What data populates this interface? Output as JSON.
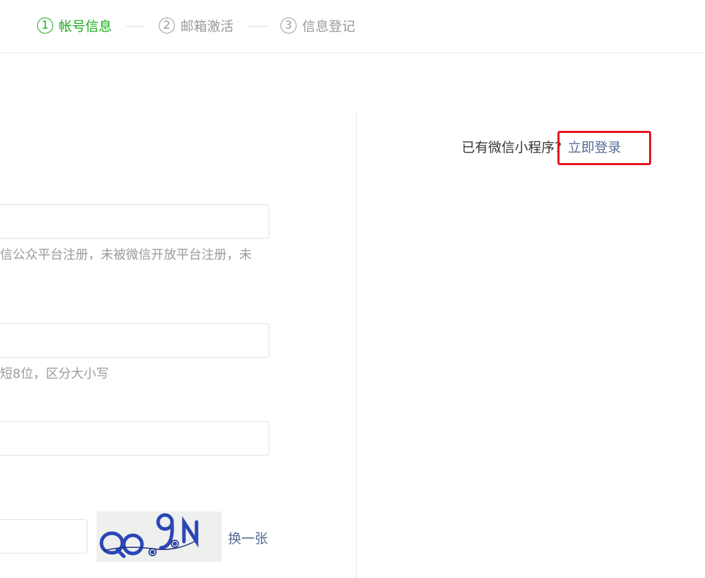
{
  "steps": [
    {
      "num": "1",
      "label": "帐号信息",
      "active": true
    },
    {
      "num": "2",
      "label": "邮箱激活",
      "active": false
    },
    {
      "num": "3",
      "label": "信息登记",
      "active": false
    }
  ],
  "form": {
    "email_tip": "信公众平台注册，未被微信开放平台注册，未",
    "password_tip": "短8位，区分大小写",
    "captcha_text": "QOGN",
    "refresh_label": "换一张"
  },
  "side": {
    "question": "已有微信小程序？",
    "login_link": "立即登录"
  },
  "colors": {
    "active_step": "#1aad19",
    "link": "#576b95",
    "highlight": "#e0181e"
  }
}
